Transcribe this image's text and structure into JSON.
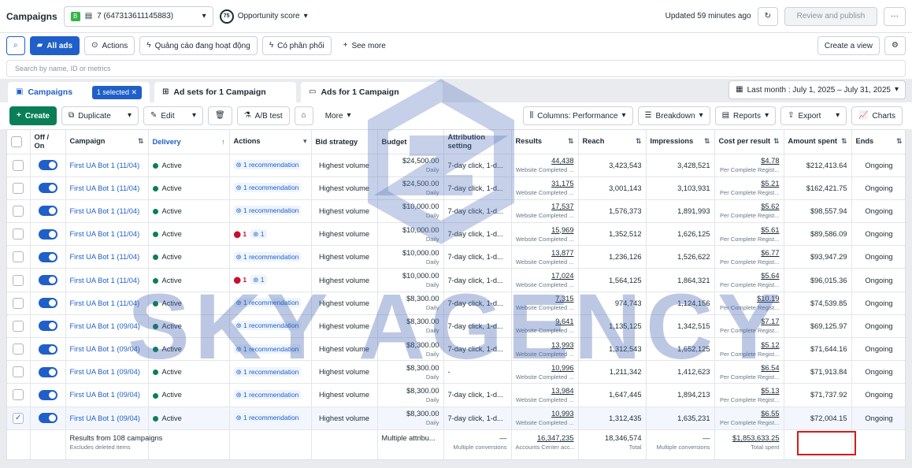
{
  "topbar": {
    "title": "Campaigns",
    "account_badge": "B",
    "account": "7 (647313611145883)",
    "score_value": "75",
    "score_label": "Opportunity score",
    "updated": "Updated 59 minutes ago",
    "review_label": "Review and publish",
    "more_label": "···"
  },
  "filterbar": {
    "all_ads": "All ads",
    "actions": "Actions",
    "filter1": "Quảng cáo đang hoạt động",
    "filter2": "Có phân phối",
    "see_more": "See more",
    "create_view": "Create a view",
    "search_placeholder": "Search by name, ID or metrics"
  },
  "tabs": {
    "campaigns": "Campaigns",
    "selected": "1 selected",
    "adsets": "Ad sets for 1 Campaign",
    "ads": "Ads for 1 Campaign"
  },
  "daterange": "Last month : July 1, 2025 – July 31, 2025",
  "toolbar": {
    "create": "Create",
    "duplicate": "Duplicate",
    "edit": "Edit",
    "abtest": "A/B test",
    "more": "More",
    "columns": "Columns: Performance",
    "breakdown": "Breakdown",
    "reports": "Reports",
    "export": "Export",
    "charts": "Charts"
  },
  "columns": [
    "Off / On",
    "Campaign",
    "Delivery",
    "Actions",
    "Bid strategy",
    "Budget",
    "Attribution setting",
    "Results",
    "Reach",
    "Impressions",
    "Cost per result",
    "Amount spent",
    "Ends"
  ],
  "rows": [
    {
      "campaign": "First UA Bot 1 (11/04)",
      "delivery": "Active",
      "rec": "1 recommendation",
      "err": "",
      "bid": "Highest volume",
      "budget": "$24,500.00",
      "budget_sub": "Daily",
      "attr": "7-day click, 1-d...",
      "results": "44,438",
      "results_sub": "Website Completed ...",
      "reach": "3,423,543",
      "impr": "3,428,521",
      "cpr": "$4.78",
      "cpr_sub": "Per Complete Regist...",
      "spent": "$212,413.64",
      "ends": "Ongoing",
      "checked": false
    },
    {
      "campaign": "First UA Bot 1 (11/04)",
      "delivery": "Active",
      "rec": "1 recommendation",
      "err": "",
      "bid": "Highest volume",
      "budget": "$24,500.00",
      "budget_sub": "Daily",
      "attr": "7-day click, 1-d...",
      "results": "31,175",
      "results_sub": "Website Completed ...",
      "reach": "3,001,143",
      "impr": "3,103,931",
      "cpr": "$5.21",
      "cpr_sub": "Per Complete Regist...",
      "spent": "$162,421.75",
      "ends": "Ongoing",
      "checked": false
    },
    {
      "campaign": "First UA Bot 1 (11/04)",
      "delivery": "Active",
      "rec": "1 recommendation",
      "err": "",
      "bid": "Highest volume",
      "budget": "$10,000.00",
      "budget_sub": "Daily",
      "attr": "7-day click, 1-d...",
      "results": "17,537",
      "results_sub": "Website Completed ...",
      "reach": "1,576,373",
      "impr": "1,891,993",
      "cpr": "$5.62",
      "cpr_sub": "Per Complete Regist...",
      "spent": "$98,557.94",
      "ends": "Ongoing",
      "checked": false
    },
    {
      "campaign": "First UA Bot 1 (11/04)",
      "delivery": "Active",
      "rec": "1",
      "err": "1",
      "bid": "Highest volume",
      "budget": "$10,000.00",
      "budget_sub": "Daily",
      "attr": "7-day click, 1-d...",
      "results": "15,969",
      "results_sub": "Website Completed ...",
      "reach": "1,352,512",
      "impr": "1,626,125",
      "cpr": "$5.61",
      "cpr_sub": "Per Complete Regist...",
      "spent": "$89,586.09",
      "ends": "Ongoing",
      "checked": false
    },
    {
      "campaign": "First UA Bot 1 (11/04)",
      "delivery": "Active",
      "rec": "1 recommendation",
      "err": "",
      "bid": "Highest volume",
      "budget": "$10,000.00",
      "budget_sub": "Daily",
      "attr": "7-day click, 1-d...",
      "results": "13,877",
      "results_sub": "Website Completed ...",
      "reach": "1,236,126",
      "impr": "1,526,622",
      "cpr": "$6.77",
      "cpr_sub": "Per Complete Regist...",
      "spent": "$93,947.29",
      "ends": "Ongoing",
      "checked": false
    },
    {
      "campaign": "First UA Bot 1 (11/04)",
      "delivery": "Active",
      "rec": "1",
      "err": "1",
      "bid": "Highest volume",
      "budget": "$10,000.00",
      "budget_sub": "Daily",
      "attr": "7-day click, 1-d...",
      "results": "17,024",
      "results_sub": "Website Completed ...",
      "reach": "1,564,125",
      "impr": "1,864,321",
      "cpr": "$5.64",
      "cpr_sub": "Per Complete Regist...",
      "spent": "$96,015.36",
      "ends": "Ongoing",
      "checked": false
    },
    {
      "campaign": "First UA Bot 1 (11/04)",
      "delivery": "Active",
      "rec": "1 recommendation",
      "err": "",
      "bid": "Highest volume",
      "budget": "$8,300.00",
      "budget_sub": "Daily",
      "attr": "7-day click, 1-d...",
      "results": "7,315",
      "results_sub": "Website Completed ...",
      "reach": "974,743",
      "impr": "1,124,156",
      "cpr": "$10.19",
      "cpr_sub": "Per Complete Regist...",
      "spent": "$74,539.85",
      "ends": "Ongoing",
      "checked": false
    },
    {
      "campaign": "First UA Bot 1 (09/04)",
      "delivery": "Active",
      "rec": "1 recommendation",
      "err": "",
      "bid": "Highest volume",
      "budget": "$8,300.00",
      "budget_sub": "Daily",
      "attr": "7-day click, 1-d...",
      "results": "9,641",
      "results_sub": "Website Completed ...",
      "reach": "1,135,125",
      "impr": "1,342,515",
      "cpr": "$7.17",
      "cpr_sub": "Per Complete Regist...",
      "spent": "$69,125.97",
      "ends": "Ongoing",
      "checked": false
    },
    {
      "campaign": "First UA Bot 1 (09/04)",
      "delivery": "Active",
      "rec": "1 recommendation",
      "err": "",
      "bid": "Highest volume",
      "budget": "$8,300.00",
      "budget_sub": "Daily",
      "attr": "7-day click, 1-d...",
      "results": "13,993",
      "results_sub": "Website Completed ...",
      "reach": "1,312,543",
      "impr": "1,652,125",
      "cpr": "$5.12",
      "cpr_sub": "Per Complete Regist...",
      "spent": "$71,644.16",
      "ends": "Ongoing",
      "checked": false
    },
    {
      "campaign": "First UA Bot 1 (09/04)",
      "delivery": "Active",
      "rec": "1 recommendation",
      "err": "",
      "bid": "Highest volume",
      "budget": "$8,300.00",
      "budget_sub": "Daily",
      "attr": "-",
      "results": "10,996",
      "results_sub": "Website Completed ...",
      "reach": "1,211,342",
      "impr": "1,412,623",
      "cpr": "$6.54",
      "cpr_sub": "Per Complete Regist...",
      "spent": "$71,913.84",
      "ends": "Ongoing",
      "checked": false
    },
    {
      "campaign": "First UA Bot 1 (09/04)",
      "delivery": "Active",
      "rec": "1 recommendation",
      "err": "",
      "bid": "Highest volume",
      "budget": "$8,300.00",
      "budget_sub": "Daily",
      "attr": "7-day click, 1-d...",
      "results": "13,984",
      "results_sub": "Website Completed ...",
      "reach": "1,647,445",
      "impr": "1,894,213",
      "cpr": "$5.13",
      "cpr_sub": "Per Complete Regist...",
      "spent": "$71,737.92",
      "ends": "Ongoing",
      "checked": false
    },
    {
      "campaign": "First UA Bot 1 (09/04)",
      "delivery": "Active",
      "rec": "1 recommendation",
      "err": "",
      "bid": "Highest volume",
      "budget": "$8,300.00",
      "budget_sub": "Daily",
      "attr": "7-day click, 1-d...",
      "results": "10,993",
      "results_sub": "Website Completed ...",
      "reach": "1,312,435",
      "impr": "1,635,231",
      "cpr": "$6.55",
      "cpr_sub": "Per Complete Regist...",
      "spent": "$72,004.15",
      "ends": "Ongoing",
      "checked": true
    }
  ],
  "summary": {
    "label": "Results from 108 campaigns",
    "label_sub": "Excludes deleted items",
    "attr": "Multiple attribu...",
    "results": "—",
    "results_sub": "Multiple conversions",
    "reach": "16,347,235",
    "reach_sub": "Accounts Center acc...",
    "impr": "18,346,574",
    "impr_sub": "Total",
    "cpr": "—",
    "cpr_sub": "Multiple conversions",
    "spent": "$1,853,633.25",
    "spent_sub": "Total spent"
  },
  "watermark": "SKY AGENCY",
  "colors": {
    "accent": "#1f5fc7",
    "create": "#0a7f57",
    "highlight": "#d41b1b"
  }
}
